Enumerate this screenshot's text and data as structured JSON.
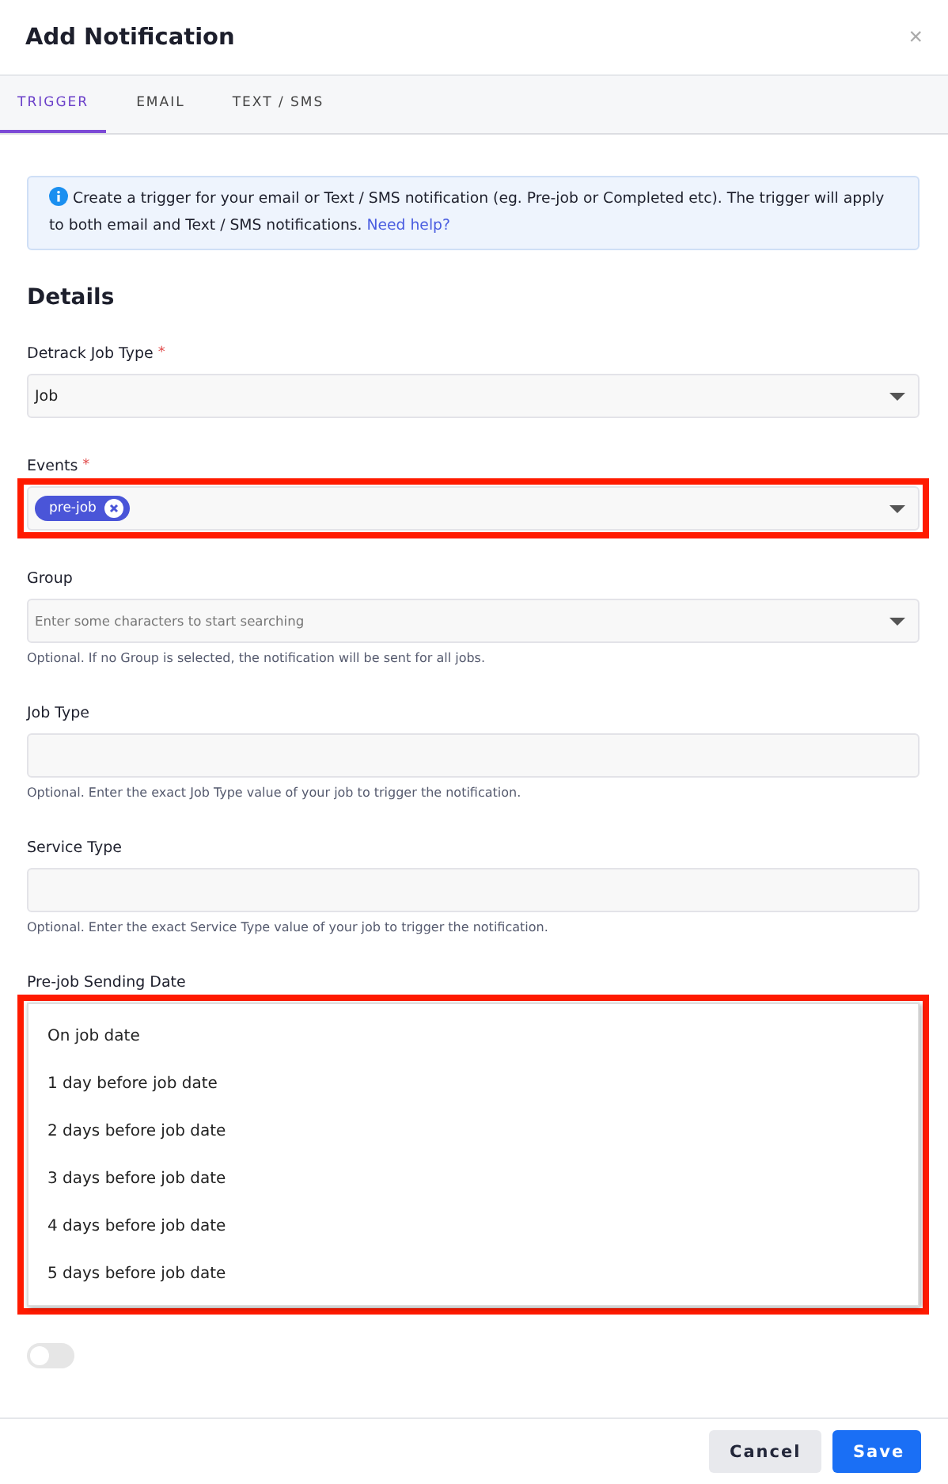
{
  "dialog": {
    "title": "Add Notification",
    "close": "×"
  },
  "tabs": [
    {
      "label": "TRIGGER",
      "selected": true
    },
    {
      "label": "EMAIL",
      "selected": false
    },
    {
      "label": "TEXT / SMS",
      "selected": false
    }
  ],
  "info": {
    "text": "Create a trigger for your email or Text / SMS notification (eg. Pre-job or Completed etc). The trigger will apply to both email and Text / SMS notifications.",
    "link": "Need help?"
  },
  "section_title": "Details",
  "fields": [
    {
      "kind": "select",
      "label": "Detrack Job Type",
      "required_mark": "*",
      "value": "Job",
      "highlighted": false
    },
    {
      "kind": "tags",
      "label": "Events",
      "required_mark": "*",
      "tags": [
        "pre-job"
      ],
      "highlighted": true
    },
    {
      "kind": "select",
      "label": "Group",
      "placeholder": "Enter some characters to start searching",
      "help": "Optional. If no Group is selected, the notification will be sent for all jobs.",
      "highlighted": false
    },
    {
      "kind": "text",
      "label": "Job Type",
      "help": "Optional. Enter the exact Job Type value of your job to trigger the notification.",
      "highlighted": false
    },
    {
      "kind": "text",
      "label": "Service Type",
      "help": "Optional. Enter the exact Service Type value of your job to trigger the notification.",
      "highlighted": false
    }
  ],
  "sending_date": {
    "label": "Pre-job Sending Date",
    "highlighted": true,
    "options": [
      "On job date",
      "1 day before job date",
      "2 days before job date",
      "3 days before job date",
      "4 days before job date",
      "5 days before job date"
    ]
  },
  "toggle": {
    "on": false
  },
  "buttons": [
    {
      "label": "Cancel",
      "kind": "secondary"
    },
    {
      "label": "Save",
      "kind": "primary"
    }
  ]
}
